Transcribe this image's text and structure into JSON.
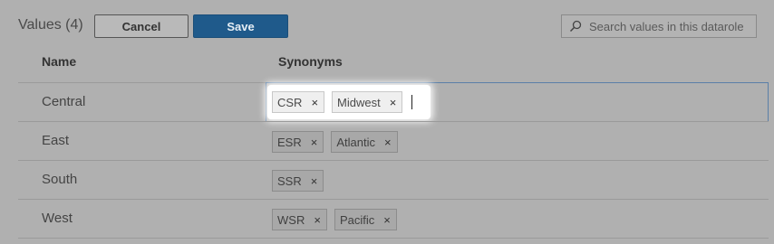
{
  "header": {
    "title": "Values (4)",
    "cancel_label": "Cancel",
    "save_label": "Save"
  },
  "search": {
    "placeholder": "Search values in this datarole",
    "value": ""
  },
  "table": {
    "columns": [
      "Name",
      "Synonyms"
    ],
    "rows": [
      {
        "name": "Central",
        "synonyms": [
          "CSR",
          "Midwest"
        ],
        "editing": true
      },
      {
        "name": "East",
        "synonyms": [
          "ESR",
          "Atlantic"
        ],
        "editing": false
      },
      {
        "name": "South",
        "synonyms": [
          "SSR"
        ],
        "editing": false
      },
      {
        "name": "West",
        "synonyms": [
          "WSR",
          "Pacific"
        ],
        "editing": false
      }
    ]
  },
  "icons": {
    "search": "search-icon",
    "remove": "close-icon",
    "remove_glyph": "×"
  }
}
